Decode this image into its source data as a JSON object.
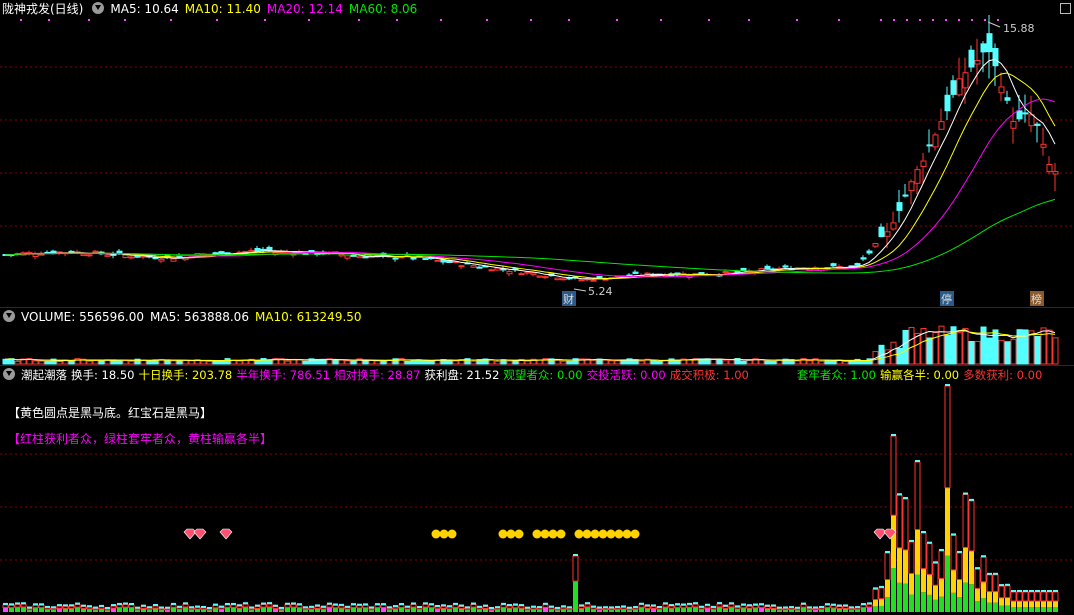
{
  "price_panel": {
    "title": "陇神戎发(日线)",
    "ma5": "MA5: 10.64",
    "ma10": "MA10: 11.40",
    "ma20": "MA20: 12.14",
    "ma60": "MA60: 8.06",
    "high_label": "15.88",
    "low_label": "5.24",
    "tags": {
      "cai": "财",
      "ting": "停",
      "bang": "榜"
    }
  },
  "volume_panel": {
    "volume": "VOLUME: 556596.00",
    "ma5": "MA5: 563888.06",
    "ma10": "MA10: 613249.50"
  },
  "indicator_panel": {
    "name": "潮起潮落",
    "huanshou": "换手: 18.50",
    "shiri": "十日换手: 203.78",
    "bannian": "半年换手: 786.51",
    "xiangdui": "相对换手: 28.87",
    "huoli": "获利盘: 21.52",
    "guanwang": "观望者众: 0.00",
    "jiaotou": "交投活跃: 0.00",
    "chengjiao": "成交积极: 1.00",
    "taolao": "套牢者众: 1.00",
    "shuying": "输赢各半: 0.00",
    "duoshu": "多数获利: 0.00",
    "note1": "【黄色圆点是黑马底。红宝石是黑马】",
    "note2": "【红柱获利者众，绿柱套牢者众，黄柱输赢各半】"
  },
  "colors": {
    "up": "#ff3232",
    "down": "#54ffff",
    "ma5": "#ffffff",
    "ma10": "#ffff00",
    "ma20": "#ff00ff",
    "ma60": "#00e600",
    "grid": "#8b0000",
    "yellow": "#ffd200",
    "green": "#22dd22"
  },
  "chart_data": [
    {
      "type": "candlestick",
      "title": "陇神戎发(日线)",
      "annotations": {
        "high": 15.88,
        "low": 5.24
      },
      "series": [
        {
          "name": "MA5",
          "value": 10.64
        },
        {
          "name": "MA10",
          "value": 11.4
        },
        {
          "name": "MA20",
          "value": 12.14
        },
        {
          "name": "MA60",
          "value": 8.06
        }
      ]
    },
    {
      "type": "bar",
      "series": [
        {
          "name": "VOLUME",
          "value": 556596.0
        },
        {
          "name": "MA5",
          "value": 563888.06
        },
        {
          "name": "MA10",
          "value": 613249.5
        }
      ]
    },
    {
      "type": "bar",
      "title": "潮起潮落",
      "series": [
        {
          "name": "换手",
          "value": 18.5
        },
        {
          "name": "十日换手",
          "value": 203.78
        },
        {
          "name": "半年换手",
          "value": 786.51
        },
        {
          "name": "相对换手",
          "value": 28.87
        },
        {
          "name": "获利盘",
          "value": 21.52
        },
        {
          "name": "观望者众",
          "value": 0.0
        },
        {
          "name": "交投活跃",
          "value": 0.0
        },
        {
          "name": "成交积极",
          "value": 1.0
        },
        {
          "name": "套牢者众",
          "value": 1.0
        },
        {
          "name": "输赢各半",
          "value": 0.0
        },
        {
          "name": "多数获利",
          "value": 0.0
        }
      ]
    }
  ]
}
